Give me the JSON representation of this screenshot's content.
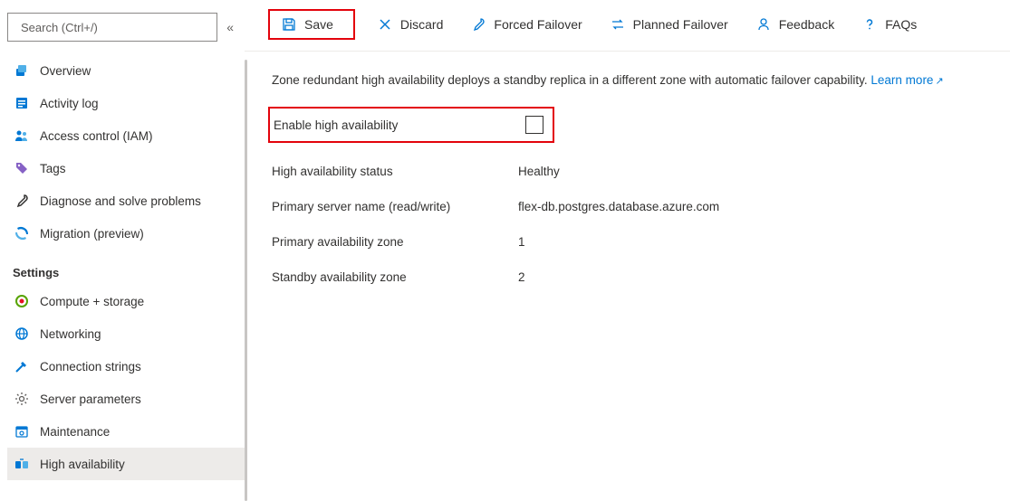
{
  "search": {
    "placeholder": "Search (Ctrl+/)"
  },
  "sidebar": {
    "items": [
      {
        "label": "Overview"
      },
      {
        "label": "Activity log"
      },
      {
        "label": "Access control (IAM)"
      },
      {
        "label": "Tags"
      },
      {
        "label": "Diagnose and solve problems"
      },
      {
        "label": "Migration (preview)"
      }
    ],
    "sections": [
      {
        "title": "Settings",
        "items": [
          {
            "label": "Compute + storage"
          },
          {
            "label": "Networking"
          },
          {
            "label": "Connection strings"
          },
          {
            "label": "Server parameters"
          },
          {
            "label": "Maintenance"
          },
          {
            "label": "High availability"
          }
        ]
      }
    ]
  },
  "toolbar": {
    "save": "Save",
    "discard": "Discard",
    "forced": "Forced Failover",
    "planned": "Planned Failover",
    "feedback": "Feedback",
    "faqs": "FAQs"
  },
  "content": {
    "description": "Zone redundant high availability deploys a standby replica in a different zone with automatic failover capability.",
    "learn_more": "Learn more",
    "fields": {
      "enable_label": "Enable high availability",
      "enable_checked": false,
      "status_label": "High availability status",
      "status_value": "Healthy",
      "primary_name_label": "Primary server name (read/write)",
      "primary_name_value": "flex-db.postgres.database.azure.com",
      "primary_zone_label": "Primary availability zone",
      "primary_zone_value": "1",
      "standby_zone_label": "Standby availability zone",
      "standby_zone_value": "2"
    }
  }
}
